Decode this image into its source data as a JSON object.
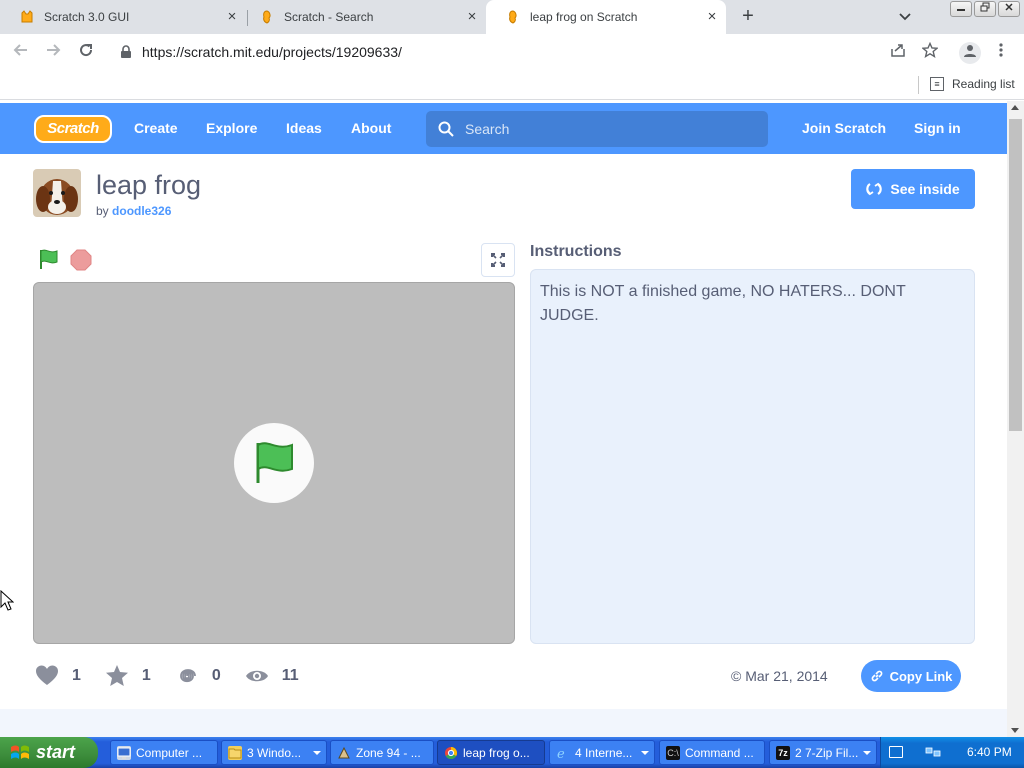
{
  "browser": {
    "tabs": [
      {
        "title": "Scratch 3.0 GUI",
        "favicon": "scratch-cat-icon",
        "active": false
      },
      {
        "title": "Scratch - Search",
        "favicon": "scratch-icon",
        "active": false
      },
      {
        "title": "leap frog on Scratch",
        "favicon": "scratch-icon",
        "active": true
      }
    ],
    "new_tab_label": "+",
    "url": "https://scratch.mit.edu/projects/19209633/",
    "reading_list_label": "Reading list"
  },
  "scratch": {
    "logo_text": "Scratch",
    "nav": {
      "create": "Create",
      "explore": "Explore",
      "ideas": "Ideas",
      "about": "About"
    },
    "search_placeholder": "Search",
    "join": "Join Scratch",
    "signin": "Sign in",
    "accent_color": "#4d97ff"
  },
  "project": {
    "title": "leap frog",
    "by_label": "by",
    "author": "doodle326",
    "see_inside": "See inside",
    "instructions_heading": "Instructions",
    "instructions": "This is NOT a finished game, NO HATERS... DONT JUDGE.",
    "stats": {
      "loves": "1",
      "favorites": "1",
      "remixes": "0",
      "views": "11"
    },
    "date": "Mar 21, 2014",
    "copy_link": "Copy Link"
  },
  "taskbar": {
    "start": "start",
    "tasks": [
      {
        "label": "Computer ...",
        "icon": "computer-icon",
        "has_arrow": false
      },
      {
        "label": "3 Windo...",
        "icon": "folder-icon",
        "has_arrow": true
      },
      {
        "label": "Zone 94 - ...",
        "icon": "app-icon",
        "has_arrow": false
      },
      {
        "label": "leap frog o...",
        "icon": "chrome-icon",
        "has_arrow": false,
        "active": true
      },
      {
        "label": "4 Interne...",
        "icon": "ie-icon",
        "has_arrow": true
      },
      {
        "label": "Command ...",
        "icon": "cmd-icon",
        "has_arrow": false
      },
      {
        "label": "2 7-Zip Fil...",
        "icon": "7zip-icon",
        "has_arrow": true
      }
    ],
    "clock": "6:40 PM"
  }
}
